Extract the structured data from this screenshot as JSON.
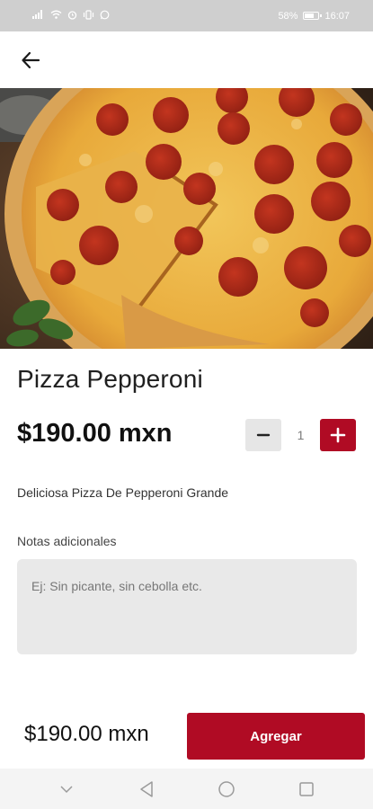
{
  "status_bar": {
    "battery_percent_text": "58%",
    "battery_level": 0.58,
    "time": "16:07",
    "left_icons": [
      "signal-icon",
      "wifi-icon",
      "alarm-icon",
      "vibrate-icon",
      "whatsapp-icon"
    ]
  },
  "header": {
    "back_icon": "arrow-left-icon"
  },
  "product": {
    "image_alt": "pizza-pepperoni-photo",
    "name": "Pizza Pepperoni",
    "price": "$190.00 mxn",
    "quantity": "1",
    "description": "Deliciosa Pizza De Pepperoni Grande"
  },
  "notes": {
    "label": "Notas adicionales",
    "placeholder": "Ej: Sin picante, sin cebolla etc.",
    "value": ""
  },
  "footer": {
    "total": "$190.00 mxn",
    "add_label": "Agregar"
  },
  "colors": {
    "accent": "#b00b24",
    "status_bar": "#cfcfcf",
    "field_bg": "#e9e9e9",
    "minus_bg": "#e6e6e6"
  },
  "nav_bar": {
    "icons": [
      "chevron-down-icon",
      "back-triangle-icon",
      "home-circle-icon",
      "recents-square-icon"
    ]
  }
}
